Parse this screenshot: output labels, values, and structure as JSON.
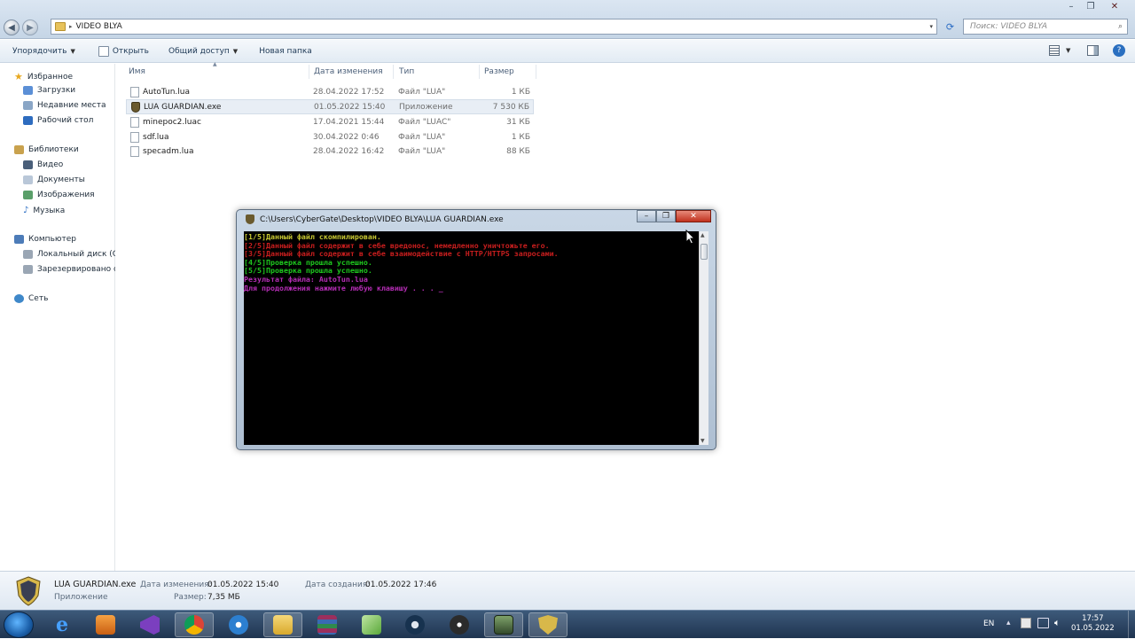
{
  "window": {
    "address_path": "VIDEO BLYA",
    "search_placeholder": "Поиск: VIDEO BLYA"
  },
  "toolbar": {
    "organize": "Упорядочить",
    "open": "Открыть",
    "share": "Общий доступ",
    "new_folder": "Новая папка"
  },
  "nav": {
    "favorites": "Избранное",
    "downloads": "Загрузки",
    "recent": "Недавние места",
    "desktop": "Рабочий стол",
    "libraries": "Библиотеки",
    "video": "Видео",
    "documents": "Документы",
    "images": "Изображения",
    "music": "Музыка",
    "computer": "Компьютер",
    "local_disk": "Локальный диск (C:",
    "reserved": "Зарезервировано си",
    "network": "Сеть"
  },
  "columns": {
    "name": "Имя",
    "date": "Дата изменения",
    "type": "Тип",
    "size": "Размер"
  },
  "files": [
    {
      "name": "AutoTun.lua",
      "date": "28.04.2022 17:52",
      "type": "Файл \"LUA\"",
      "size": "1 КБ"
    },
    {
      "name": "LUA GUARDIAN.exe",
      "date": "01.05.2022 15:40",
      "type": "Приложение",
      "size": "7 530 КБ"
    },
    {
      "name": "minepoc2.luac",
      "date": "17.04.2021 15:44",
      "type": "Файл \"LUAC\"",
      "size": "31 КБ"
    },
    {
      "name": "sdf.lua",
      "date": "30.04.2022 0:46",
      "type": "Файл \"LUA\"",
      "size": "1 КБ"
    },
    {
      "name": "specadm.lua",
      "date": "28.04.2022 16:42",
      "type": "Файл \"LUA\"",
      "size": "88 КБ"
    }
  ],
  "console": {
    "title": "C:\\Users\\CyberGate\\Desktop\\VIDEO BLYA\\LUA GUARDIAN.exe",
    "lines": [
      {
        "text": "[1/5]Данный файл скомпилирован.",
        "color": "#c8c832"
      },
      {
        "text": "[2/5]Данный файл содержит в себе вредонос, немедленно уничтожьте его.",
        "color": "#c81e1e"
      },
      {
        "text": "[3/5]Данный файл содержит в себе взаимодействие с HTTP/HTTPS запросами.",
        "color": "#c81e1e"
      },
      {
        "text": "[4/5]Проверка прошла успешно.",
        "color": "#1ec81e"
      },
      {
        "text": "[5/5]Проверка прошла успешно.",
        "color": "#1ec81e"
      },
      {
        "text": "Результат файла: AutoTun.lua",
        "color": "#b42db4"
      },
      {
        "text": "Для продолжения нажмите любую клавишу . . . _",
        "color": "#b42db4"
      }
    ]
  },
  "details": {
    "filename": "LUA GUARDIAN.exe",
    "filetype": "Приложение",
    "modified_label": "Дата изменения:",
    "modified_value": "01.05.2022 15:40",
    "created_label": "Дата создания:",
    "created_value": "01.05.2022 17:46",
    "size_label": "Размер:",
    "size_value": "7,35 МБ"
  },
  "taskbar": {
    "lang": "EN",
    "time": "17:57",
    "date": "01.05.2022",
    "apps": [
      "ie-icon",
      "media-icon",
      "visual-studio-icon",
      "chrome-icon",
      "app-icon",
      "explorer-icon",
      "winrar-icon",
      "notepad-icon",
      "steam-icon",
      "obs-icon",
      "terminal-icon",
      "lua-guardian-icon"
    ]
  }
}
